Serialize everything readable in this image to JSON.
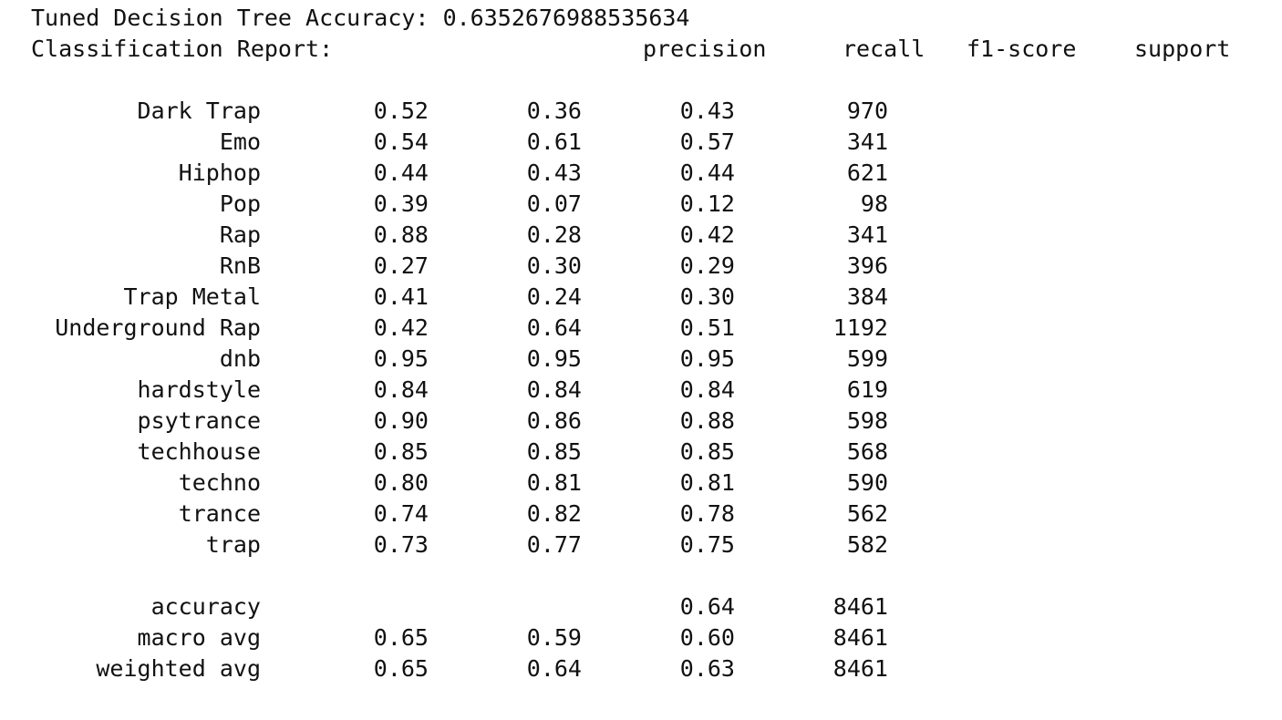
{
  "output": {
    "accuracy_label": "Tuned Decision Tree Accuracy:",
    "accuracy_value": "0.6352676988535634",
    "report_label": "Classification Report:"
  },
  "report": {
    "headers": [
      "precision",
      "recall",
      "f1-score",
      "support"
    ],
    "rows": [
      {
        "label": "Dark Trap",
        "precision": "0.52",
        "recall": "0.36",
        "f1": "0.43",
        "support": "970"
      },
      {
        "label": "Emo",
        "precision": "0.54",
        "recall": "0.61",
        "f1": "0.57",
        "support": "341"
      },
      {
        "label": "Hiphop",
        "precision": "0.44",
        "recall": "0.43",
        "f1": "0.44",
        "support": "621"
      },
      {
        "label": "Pop",
        "precision": "0.39",
        "recall": "0.07",
        "f1": "0.12",
        "support": "98"
      },
      {
        "label": "Rap",
        "precision": "0.88",
        "recall": "0.28",
        "f1": "0.42",
        "support": "341"
      },
      {
        "label": "RnB",
        "precision": "0.27",
        "recall": "0.30",
        "f1": "0.29",
        "support": "396"
      },
      {
        "label": "Trap Metal",
        "precision": "0.41",
        "recall": "0.24",
        "f1": "0.30",
        "support": "384"
      },
      {
        "label": "Underground Rap",
        "precision": "0.42",
        "recall": "0.64",
        "f1": "0.51",
        "support": "1192"
      },
      {
        "label": "dnb",
        "precision": "0.95",
        "recall": "0.95",
        "f1": "0.95",
        "support": "599"
      },
      {
        "label": "hardstyle",
        "precision": "0.84",
        "recall": "0.84",
        "f1": "0.84",
        "support": "619"
      },
      {
        "label": "psytrance",
        "precision": "0.90",
        "recall": "0.86",
        "f1": "0.88",
        "support": "598"
      },
      {
        "label": "techhouse",
        "precision": "0.85",
        "recall": "0.85",
        "f1": "0.85",
        "support": "568"
      },
      {
        "label": "techno",
        "precision": "0.80",
        "recall": "0.81",
        "f1": "0.81",
        "support": "590"
      },
      {
        "label": "trance",
        "precision": "0.74",
        "recall": "0.82",
        "f1": "0.78",
        "support": "562"
      },
      {
        "label": "trap",
        "precision": "0.73",
        "recall": "0.77",
        "f1": "0.75",
        "support": "582"
      }
    ],
    "summary": [
      {
        "label": "accuracy",
        "precision": "",
        "recall": "",
        "f1": "0.64",
        "support": "8461"
      },
      {
        "label": "macro avg",
        "precision": "0.65",
        "recall": "0.59",
        "f1": "0.60",
        "support": "8461"
      },
      {
        "label": "weighted avg",
        "precision": "0.65",
        "recall": "0.64",
        "f1": "0.63",
        "support": "8461"
      }
    ]
  }
}
